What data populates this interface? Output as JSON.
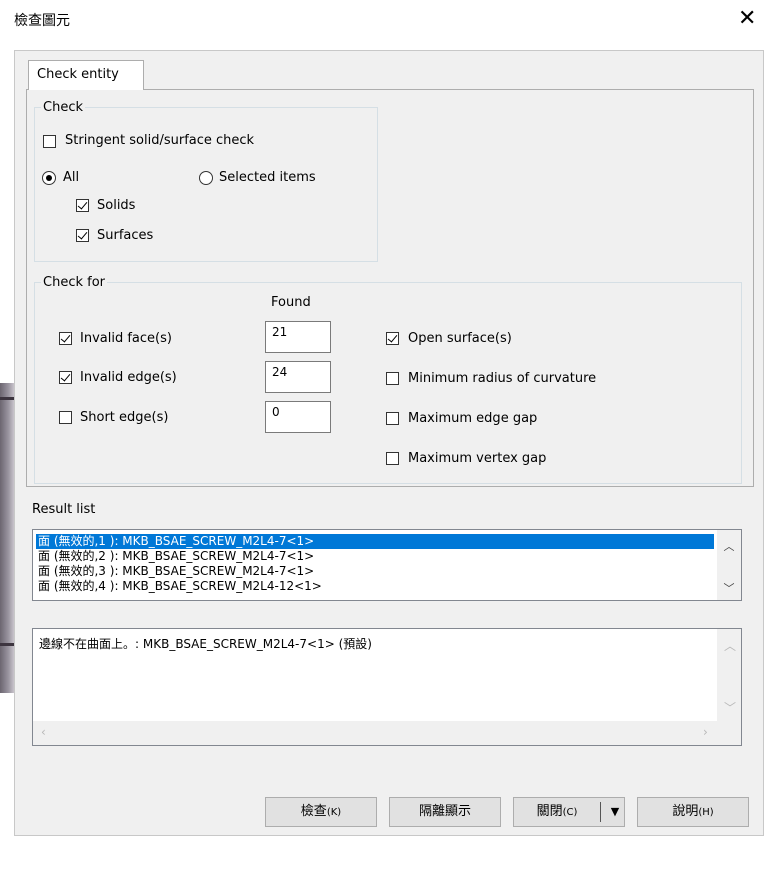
{
  "window": {
    "title": "檢查圖元"
  },
  "tabs": [
    {
      "label": "Check entity"
    }
  ],
  "check_group": {
    "legend": "Check",
    "stringent": {
      "label": "Stringent solid/surface check",
      "checked": false
    },
    "scope": {
      "all_label": "All",
      "selected_label": "Selected items",
      "value": "All"
    },
    "solids": {
      "label": "Solids",
      "checked": true
    },
    "surfaces": {
      "label": "Surfaces",
      "checked": true
    }
  },
  "check_for_group": {
    "legend": "Check for",
    "found_header": "Found",
    "left_items": [
      {
        "label": "Invalid face(s)",
        "checked": true,
        "found": "21"
      },
      {
        "label": "Invalid edge(s)",
        "checked": true,
        "found": "24"
      },
      {
        "label": "Short edge(s)",
        "checked": false,
        "found": "0"
      }
    ],
    "right_items": [
      {
        "label": "Open surface(s)",
        "checked": true
      },
      {
        "label": "Minimum radius of curvature",
        "checked": false
      },
      {
        "label": "Maximum edge gap",
        "checked": false
      },
      {
        "label": "Maximum vertex gap",
        "checked": false
      }
    ]
  },
  "result_list": {
    "label": "Result list",
    "rows": [
      "面 (無效的,1 ): MKB_BSAE_SCREW_M2L4-7<1>",
      "面 (無效的,2 ): MKB_BSAE_SCREW_M2L4-7<1>",
      "面 (無效的,3 ): MKB_BSAE_SCREW_M2L4-7<1>",
      "面 (無效的,4 ): MKB_BSAE_SCREW_M2L4-12<1>"
    ],
    "selected_index": 0
  },
  "detail": {
    "text": "邊線不在曲面上。: MKB_BSAE_SCREW_M2L4-7<1> (預設)"
  },
  "buttons": {
    "check": {
      "label": "檢查",
      "hotkey": "(K)"
    },
    "isolate": {
      "label": "隔離顯示"
    },
    "close": {
      "label": "關閉",
      "hotkey": "(C)"
    },
    "help": {
      "label": "說明",
      "hotkey": "(H)"
    }
  },
  "icons": {
    "close": "close-icon",
    "dropdown": "dropdown-arrow-icon",
    "scroll_up": "scroll-up-icon",
    "scroll_down": "scroll-down-icon"
  },
  "colors": {
    "selection": "#0078d7",
    "dialog_bg": "#f0f0f0"
  }
}
